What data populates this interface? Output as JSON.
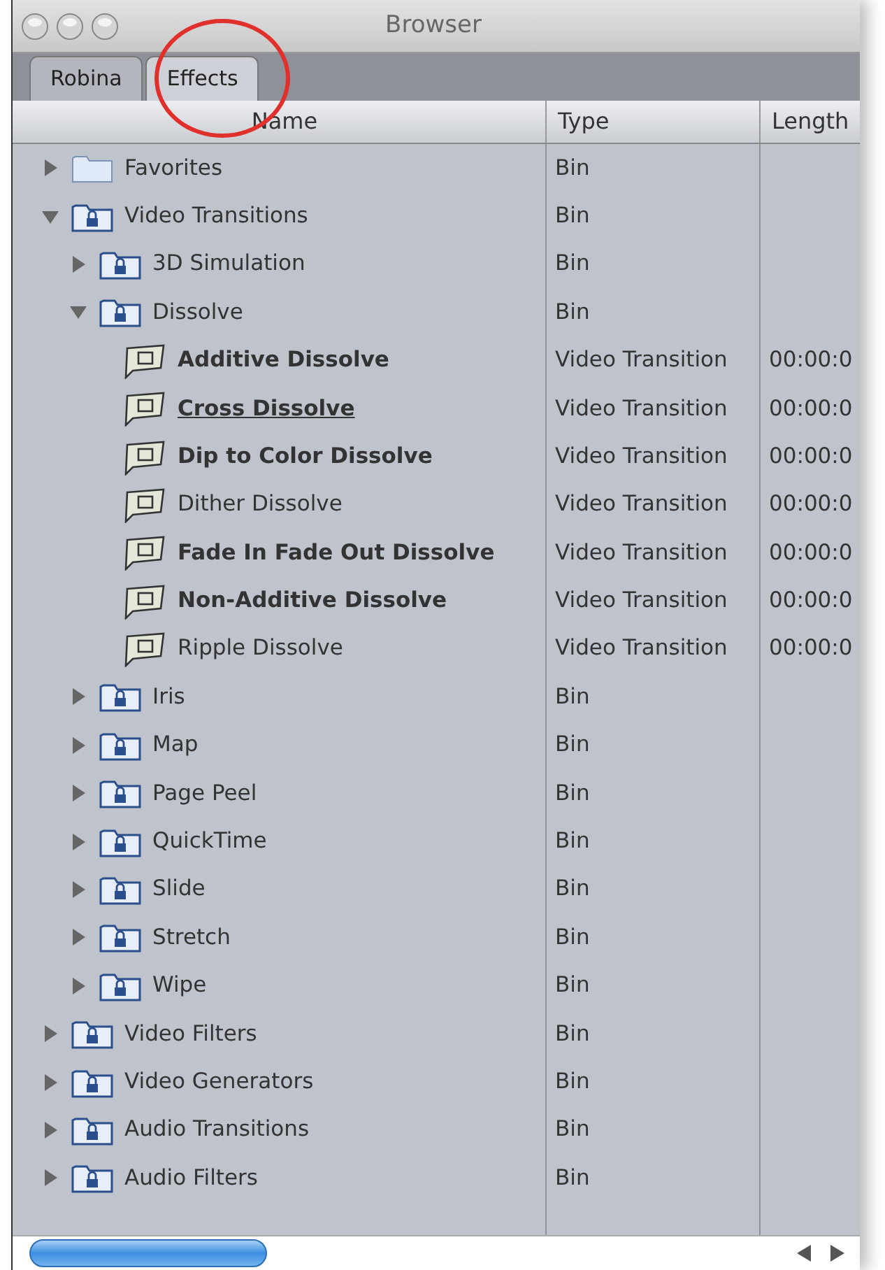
{
  "window": {
    "title": "Browser"
  },
  "tabs": [
    {
      "label": "Robina",
      "selected": false,
      "circled": false
    },
    {
      "label": "Effects",
      "selected": true,
      "circled": true
    }
  ],
  "columns": [
    "Name",
    "Type",
    "Length"
  ],
  "items": [
    {
      "kind": "folder",
      "name": "Favorites",
      "type": "Bin",
      "expanded": false
    },
    {
      "kind": "bin",
      "name": "Video Transitions",
      "type": "Bin",
      "expanded": true,
      "children": [
        {
          "kind": "bin",
          "name": "3D Simulation",
          "type": "Bin",
          "expanded": false
        },
        {
          "kind": "bin",
          "name": "Dissolve",
          "type": "Bin",
          "expanded": true,
          "children": [
            {
              "kind": "transition",
              "name": "Additive Dissolve",
              "type": "Video Transition",
              "length": "00:00:0",
              "bold": true,
              "default": false
            },
            {
              "kind": "transition",
              "name": "Cross Dissolve",
              "type": "Video Transition",
              "length": "00:00:0",
              "bold": true,
              "default": true
            },
            {
              "kind": "transition",
              "name": "Dip to Color Dissolve",
              "type": "Video Transition",
              "length": "00:00:0",
              "bold": true,
              "default": false
            },
            {
              "kind": "transition",
              "name": "Dither Dissolve",
              "type": "Video Transition",
              "length": "00:00:0",
              "bold": false,
              "default": false
            },
            {
              "kind": "transition",
              "name": "Fade In Fade Out Dissolve",
              "type": "Video Transition",
              "length": "00:00:0",
              "bold": true,
              "default": false
            },
            {
              "kind": "transition",
              "name": "Non-Additive Dissolve",
              "type": "Video Transition",
              "length": "00:00:0",
              "bold": true,
              "default": false
            },
            {
              "kind": "transition",
              "name": "Ripple Dissolve",
              "type": "Video Transition",
              "length": "00:00:0",
              "bold": false,
              "default": false
            }
          ]
        },
        {
          "kind": "bin",
          "name": "Iris",
          "type": "Bin",
          "expanded": false
        },
        {
          "kind": "bin",
          "name": "Map",
          "type": "Bin",
          "expanded": false
        },
        {
          "kind": "bin",
          "name": "Page Peel",
          "type": "Bin",
          "expanded": false
        },
        {
          "kind": "bin",
          "name": "QuickTime",
          "type": "Bin",
          "expanded": false
        },
        {
          "kind": "bin",
          "name": "Slide",
          "type": "Bin",
          "expanded": false
        },
        {
          "kind": "bin",
          "name": "Stretch",
          "type": "Bin",
          "expanded": false
        },
        {
          "kind": "bin",
          "name": "Wipe",
          "type": "Bin",
          "expanded": false
        }
      ]
    },
    {
      "kind": "bin",
      "name": "Video Filters",
      "type": "Bin",
      "expanded": false
    },
    {
      "kind": "bin",
      "name": "Video Generators",
      "type": "Bin",
      "expanded": false
    },
    {
      "kind": "bin",
      "name": "Audio Transitions",
      "type": "Bin",
      "expanded": false
    },
    {
      "kind": "bin",
      "name": "Audio Filters",
      "type": "Bin",
      "expanded": false
    }
  ]
}
